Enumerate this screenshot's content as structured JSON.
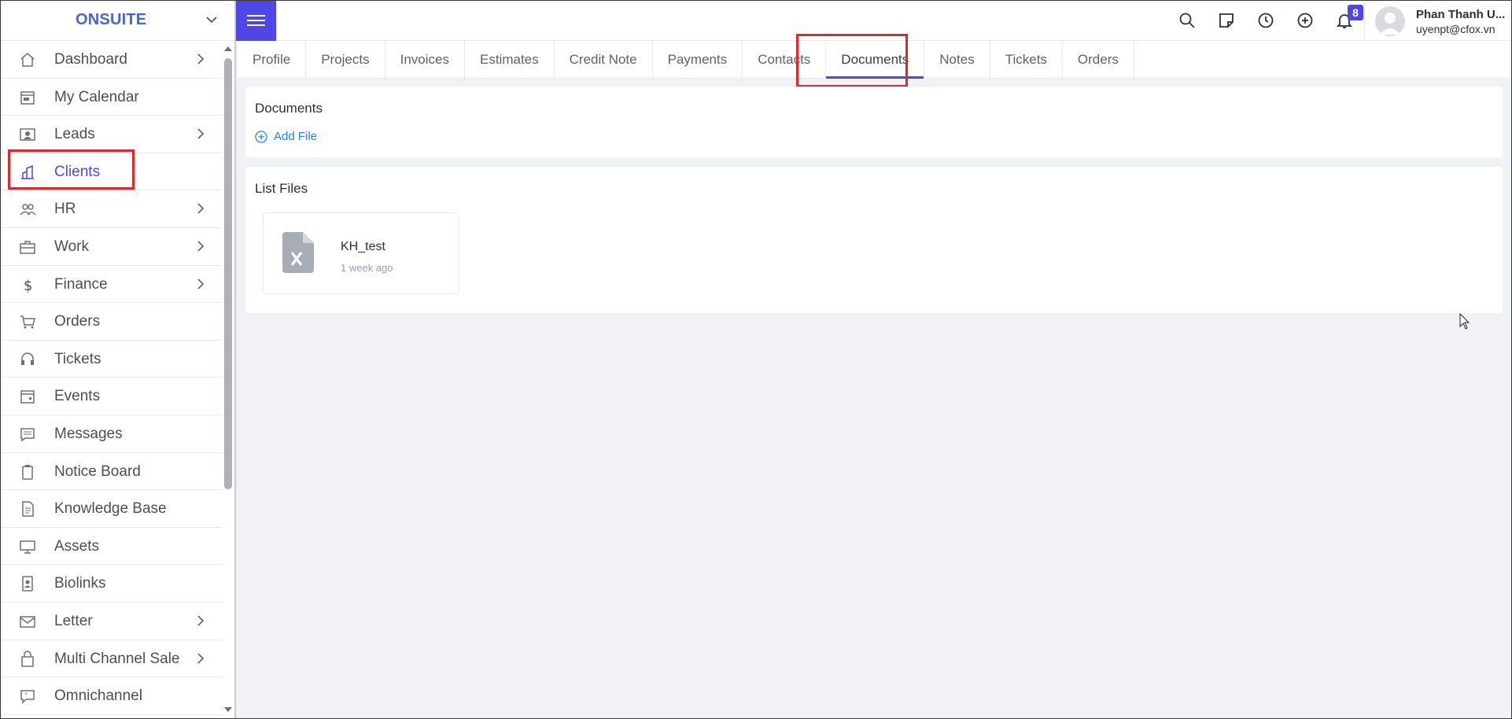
{
  "brand": {
    "name": "ONSUITE"
  },
  "sidebar": {
    "items": [
      {
        "label": "Dashboard",
        "icon": "house-icon",
        "has_submenu": true
      },
      {
        "label": "My Calendar",
        "icon": "calendar-icon",
        "has_submenu": false
      },
      {
        "label": "Leads",
        "icon": "contact-card-icon",
        "has_submenu": true
      },
      {
        "label": "Clients",
        "icon": "building-icon",
        "has_submenu": false,
        "active": true
      },
      {
        "label": "HR",
        "icon": "people-icon",
        "has_submenu": true
      },
      {
        "label": "Work",
        "icon": "briefcase-icon",
        "has_submenu": true
      },
      {
        "label": "Finance",
        "icon": "dollar-icon",
        "has_submenu": true
      },
      {
        "label": "Orders",
        "icon": "cart-icon",
        "has_submenu": false
      },
      {
        "label": "Tickets",
        "icon": "headset-icon",
        "has_submenu": false
      },
      {
        "label": "Events",
        "icon": "calendar-event-icon",
        "has_submenu": false
      },
      {
        "label": "Messages",
        "icon": "message-icon",
        "has_submenu": false
      },
      {
        "label": "Notice Board",
        "icon": "clipboard-icon",
        "has_submenu": false
      },
      {
        "label": "Knowledge Base",
        "icon": "document-icon",
        "has_submenu": false
      },
      {
        "label": "Assets",
        "icon": "monitor-icon",
        "has_submenu": false
      },
      {
        "label": "Biolinks",
        "icon": "badge-icon",
        "has_submenu": false
      },
      {
        "label": "Letter",
        "icon": "envelope-icon",
        "has_submenu": true
      },
      {
        "label": "Multi Channel Sale",
        "icon": "bag-icon",
        "has_submenu": true
      },
      {
        "label": "Omnichannel",
        "icon": "chat-quote-icon",
        "has_submenu": false
      }
    ]
  },
  "header": {
    "notification_count": "8",
    "user": {
      "name": "Phan Thanh U...",
      "email": "uyenpt@cfox.vn"
    }
  },
  "tabs": [
    {
      "label": "Profile"
    },
    {
      "label": "Projects"
    },
    {
      "label": "Invoices"
    },
    {
      "label": "Estimates"
    },
    {
      "label": "Credit Note"
    },
    {
      "label": "Payments"
    },
    {
      "label": "Contacts"
    },
    {
      "label": "Documents",
      "active": true
    },
    {
      "label": "Notes"
    },
    {
      "label": "Tickets"
    },
    {
      "label": "Orders"
    }
  ],
  "documents": {
    "title": "Documents",
    "add_label": "Add File"
  },
  "files": {
    "title": "List Files",
    "items": [
      {
        "name": "KH_test",
        "time": "1 week ago",
        "icon": "excel-file-icon"
      }
    ]
  },
  "colors": {
    "accent": "#4f46e5",
    "highlight": "#e3262b",
    "link": "#1d82f5"
  }
}
